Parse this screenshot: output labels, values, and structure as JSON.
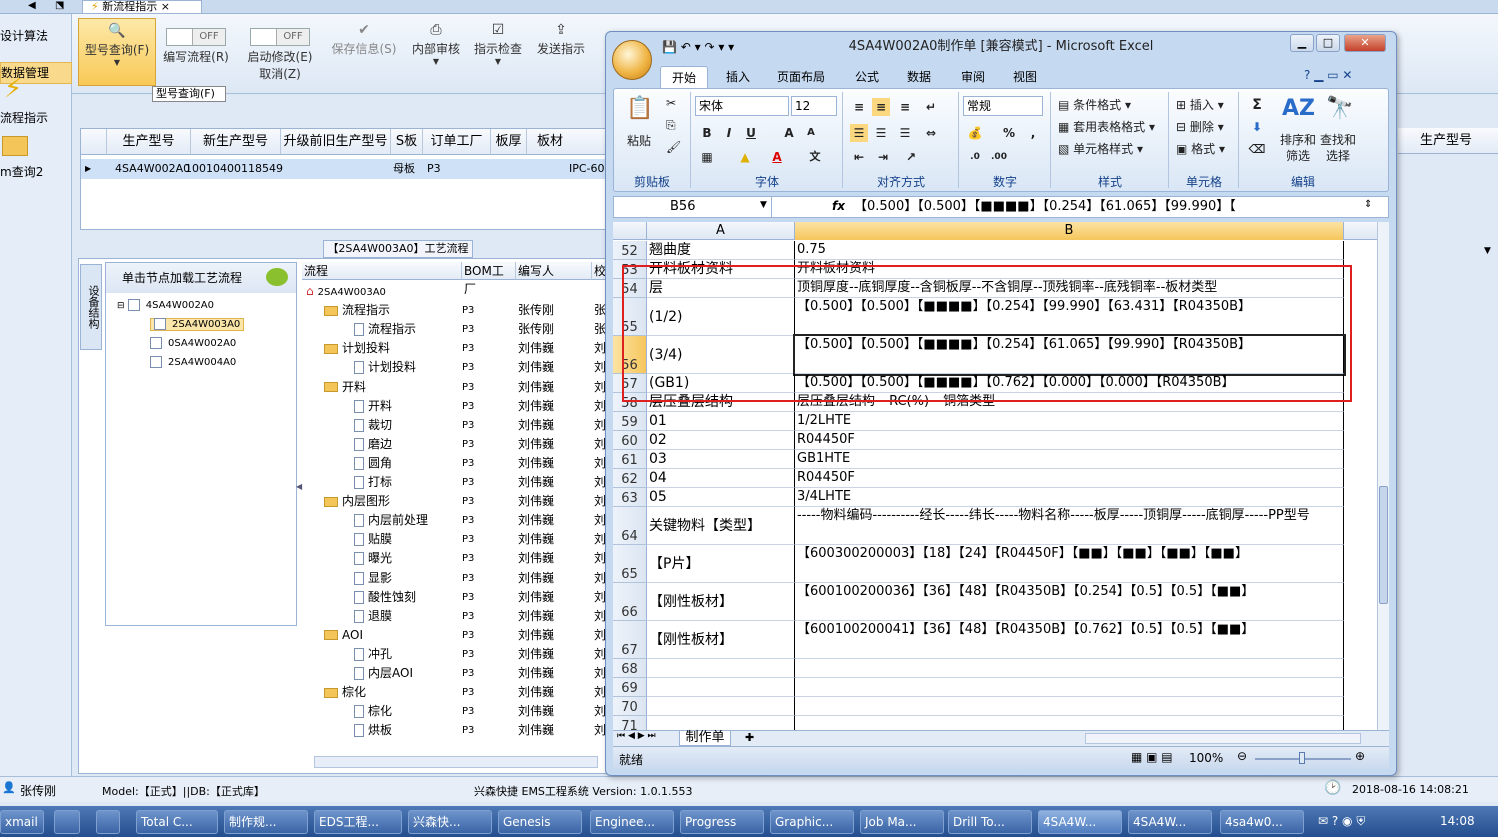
{
  "app": {
    "tab_title": "新流程指示",
    "tab_close": "×"
  },
  "leftnav": {
    "items": [
      "设计算法",
      "数据管理",
      "流程指示",
      "m查询2"
    ]
  },
  "ribbon": {
    "type_query": "型号查询(F)",
    "write_flow": "编写流程(R)",
    "start_modify": "启动修改(E)",
    "cancel_z": "取消(Z)",
    "save_info": "保存信息(S)",
    "internal_review": "内部审核",
    "indicator_check": "指示检查",
    "send_indicator": "发送指示",
    "off": "OFF",
    "tooltip": "型号查询(F)"
  },
  "grid1": {
    "headers": [
      "生产型号",
      "新生产型号",
      "升级前旧生产型号",
      "S板",
      "订单工厂",
      "板厚",
      "板材"
    ],
    "row": [
      "4SA4W002A0",
      "10010400118549",
      "母板",
      "P3",
      "IPC-60"
    ],
    "right_header": "生产型号"
  },
  "flow": {
    "title": "【2SA4W003A0】工艺流程",
    "side_tab": "设备结构",
    "tree_header": "单击节点加载工艺流程",
    "tree": [
      "4SA4W002A0",
      "2SA4W003A0",
      "0SA4W002A0",
      "2SA4W004A0"
    ],
    "headers": [
      "流程",
      "BOM工厂",
      "编写人",
      "校"
    ],
    "rows": [
      {
        "name": "2SA4W003A0",
        "bom": "",
        "writer": "",
        "check": "",
        "kind": "root"
      },
      {
        "name": "流程指示",
        "bom": "P3",
        "writer": "张传刚",
        "check": "张",
        "kind": "folder"
      },
      {
        "name": "流程指示",
        "bom": "P3",
        "writer": "张传刚",
        "check": "张",
        "kind": "doc"
      },
      {
        "name": "计划投料",
        "bom": "P3",
        "writer": "刘伟巍",
        "check": "刘",
        "kind": "folder"
      },
      {
        "name": "计划投料",
        "bom": "P3",
        "writer": "刘伟巍",
        "check": "刘",
        "kind": "doc"
      },
      {
        "name": "开料",
        "bom": "P3",
        "writer": "刘伟巍",
        "check": "刘",
        "kind": "folder"
      },
      {
        "name": "开料",
        "bom": "P3",
        "writer": "刘伟巍",
        "check": "刘",
        "kind": "doc"
      },
      {
        "name": "裁切",
        "bom": "P3",
        "writer": "刘伟巍",
        "check": "刘",
        "kind": "doc"
      },
      {
        "name": "磨边",
        "bom": "P3",
        "writer": "刘伟巍",
        "check": "刘",
        "kind": "doc"
      },
      {
        "name": "圆角",
        "bom": "P3",
        "writer": "刘伟巍",
        "check": "刘",
        "kind": "doc"
      },
      {
        "name": "打标",
        "bom": "P3",
        "writer": "刘伟巍",
        "check": "刘",
        "kind": "doc"
      },
      {
        "name": "内层图形",
        "bom": "P3",
        "writer": "刘伟巍",
        "check": "刘",
        "kind": "folder"
      },
      {
        "name": "内层前处理",
        "bom": "P3",
        "writer": "刘伟巍",
        "check": "刘",
        "kind": "doc"
      },
      {
        "name": "贴膜",
        "bom": "P3",
        "writer": "刘伟巍",
        "check": "刘",
        "kind": "doc"
      },
      {
        "name": "曝光",
        "bom": "P3",
        "writer": "刘伟巍",
        "check": "刘",
        "kind": "doc"
      },
      {
        "name": "显影",
        "bom": "P3",
        "writer": "刘伟巍",
        "check": "刘",
        "kind": "doc"
      },
      {
        "name": "酸性蚀刻",
        "bom": "P3",
        "writer": "刘伟巍",
        "check": "刘",
        "kind": "doc"
      },
      {
        "name": "退膜",
        "bom": "P3",
        "writer": "刘伟巍",
        "check": "刘",
        "kind": "doc"
      },
      {
        "name": "AOI",
        "bom": "P3",
        "writer": "刘伟巍",
        "check": "刘",
        "kind": "folder"
      },
      {
        "name": "冲孔",
        "bom": "P3",
        "writer": "刘伟巍",
        "check": "刘",
        "kind": "doc"
      },
      {
        "name": "内层AOI",
        "bom": "P3",
        "writer": "刘伟巍",
        "check": "刘",
        "kind": "doc"
      },
      {
        "name": "棕化",
        "bom": "P3",
        "writer": "刘伟巍",
        "check": "刘",
        "kind": "folder"
      },
      {
        "name": "棕化",
        "bom": "P3",
        "writer": "刘伟巍",
        "check": "刘",
        "kind": "doc"
      },
      {
        "name": "烘板",
        "bom": "P3",
        "writer": "刘伟巍",
        "check": "刘",
        "kind": "doc"
      }
    ]
  },
  "status": {
    "user": "张传刚",
    "model": "Model:【正式】||DB:【正式库】",
    "system": "兴森快捷 EMS工程系统 Version: 1.0.1.553",
    "datetime": "2018-08-16 14:08:21"
  },
  "taskbar": {
    "items": [
      "xmail",
      "Total C...",
      "制作规...",
      "EDS工程...",
      "兴森快...",
      "Genesis",
      "Enginee...",
      "Progress",
      "Graphic...",
      "Job Ma...",
      "Drill To...",
      "4SA4W...",
      "4SA4W...",
      "4sa4w0..."
    ],
    "time": "14:08"
  },
  "excel": {
    "title": "4SA4W002A0制作单 [兼容模式] - Microsoft Excel",
    "tabs": [
      "开始",
      "插入",
      "页面布局",
      "公式",
      "数据",
      "审阅",
      "视图"
    ],
    "groups": [
      "剪贴板",
      "字体",
      "对齐方式",
      "数字",
      "样式",
      "单元格",
      "编辑"
    ],
    "paste": "粘贴",
    "font_name": "宋体",
    "font_size": "12",
    "number_format": "常规",
    "cond_format": "条件格式",
    "table_format": "套用表格格式",
    "cell_style": "单元格样式",
    "insert": "插入",
    "delete": "删除",
    "format": "格式",
    "sort_filter": "排序和筛选",
    "find_select": "查找和选择",
    "name_box": "B56",
    "formula": "【0.500】【0.500】【■■■■】【0.254】【61.065】【99.990】【",
    "col_a": "A",
    "col_b": "B",
    "rows": [
      {
        "num": "52",
        "a": "翘曲度",
        "b": "0.75",
        "h": 19
      },
      {
        "num": "53",
        "a": "开料板材资料",
        "b": "开料板材资料",
        "h": 19
      },
      {
        "num": "54",
        "a": "层",
        "b": "顶铜厚度--底铜厚度--含铜板厚--不含铜厚--顶残铜率--底残铜率--板材类型",
        "h": 19
      },
      {
        "num": "55",
        "a": "(1/2)",
        "b": "【0.500】【0.500】【■■■■】【0.254】【99.990】【63.431】【R04350B】",
        "h": 38
      },
      {
        "num": "56",
        "a": "(3/4)",
        "b": "【0.500】【0.500】【■■■■】【0.254】【61.065】【99.990】【R04350B】",
        "h": 38
      },
      {
        "num": "57",
        "a": "(GB1)",
        "b": "【0.500】【0.500】【■■■■】【0.762】【0.000】【0.000】【R04350B】",
        "h": 19
      },
      {
        "num": "58",
        "a": "层压叠层结构",
        "b": "层压叠层结构---RC(%)---铜箔类型",
        "h": 19
      },
      {
        "num": "59",
        "a": "01",
        "b": "1/2LHTE",
        "h": 19
      },
      {
        "num": "60",
        "a": "02",
        "b": "R04450F",
        "h": 19
      },
      {
        "num": "61",
        "a": "03",
        "b": "GB1HTE",
        "h": 19
      },
      {
        "num": "62",
        "a": "04",
        "b": "R04450F",
        "h": 19
      },
      {
        "num": "63",
        "a": "05",
        "b": "3/4LHTE",
        "h": 19
      },
      {
        "num": "64",
        "a": "关键物料【类型】",
        "b": "-----物料编码----------经长-----纬长-----物料名称-----板厚-----顶铜厚-----底铜厚-----PP型号",
        "h": 38
      },
      {
        "num": "65",
        "a": "【P片】",
        "b": "【600300200003】【18】【24】【R04450F】【■■】【■■】【■■】【■■】",
        "h": 38
      },
      {
        "num": "66",
        "a": "【刚性板材】",
        "b": "【600100200036】【36】【48】【R04350B】【0.254】【0.5】【0.5】【■■】",
        "h": 38
      },
      {
        "num": "67",
        "a": "【刚性板材】",
        "b": "【600100200041】【36】【48】【R04350B】【0.762】【0.5】【0.5】【■■】",
        "h": 38
      },
      {
        "num": "68",
        "a": "",
        "b": "",
        "h": 19
      },
      {
        "num": "69",
        "a": "",
        "b": "",
        "h": 19
      },
      {
        "num": "70",
        "a": "",
        "b": "",
        "h": 19
      },
      {
        "num": "71",
        "a": "",
        "b": "",
        "h": 19
      }
    ],
    "sheet_tab": "制作单",
    "ready": "就绪",
    "zoom": "100%"
  }
}
